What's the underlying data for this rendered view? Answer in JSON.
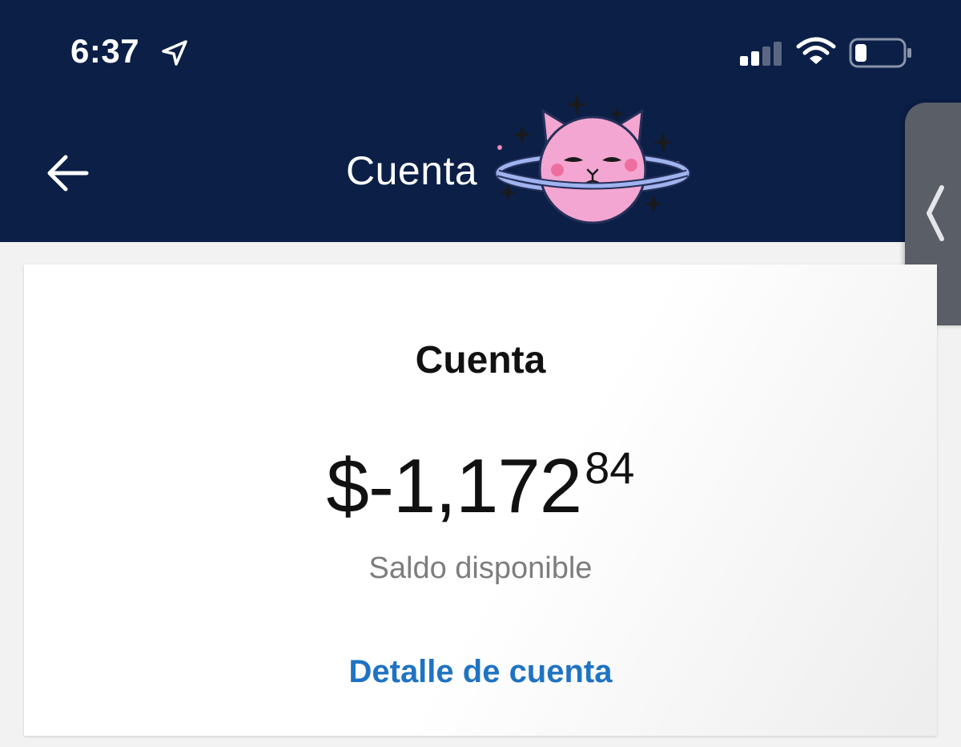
{
  "status_bar": {
    "time": "6:37",
    "icons": [
      "location-arrow-icon",
      "cellular-signal-icon",
      "wifi-icon",
      "battery-icon"
    ]
  },
  "nav": {
    "back_icon": "arrow-left-icon",
    "title": "Cuenta",
    "sticker": "pink-cat-planet-sticker"
  },
  "side_tab": {
    "icon": "chevron-left-icon"
  },
  "account_card": {
    "title": "Cuenta",
    "balance_main": "$-1,172",
    "balance_cents": "84",
    "balance_label": "Saldo disponible",
    "detail_link": "Detalle de cuenta"
  },
  "colors": {
    "header_bg": "#0b1f47",
    "link": "#1f73c2",
    "sticker_pink": "#f2a3cf",
    "sticker_ring": "#8fa8e8"
  }
}
